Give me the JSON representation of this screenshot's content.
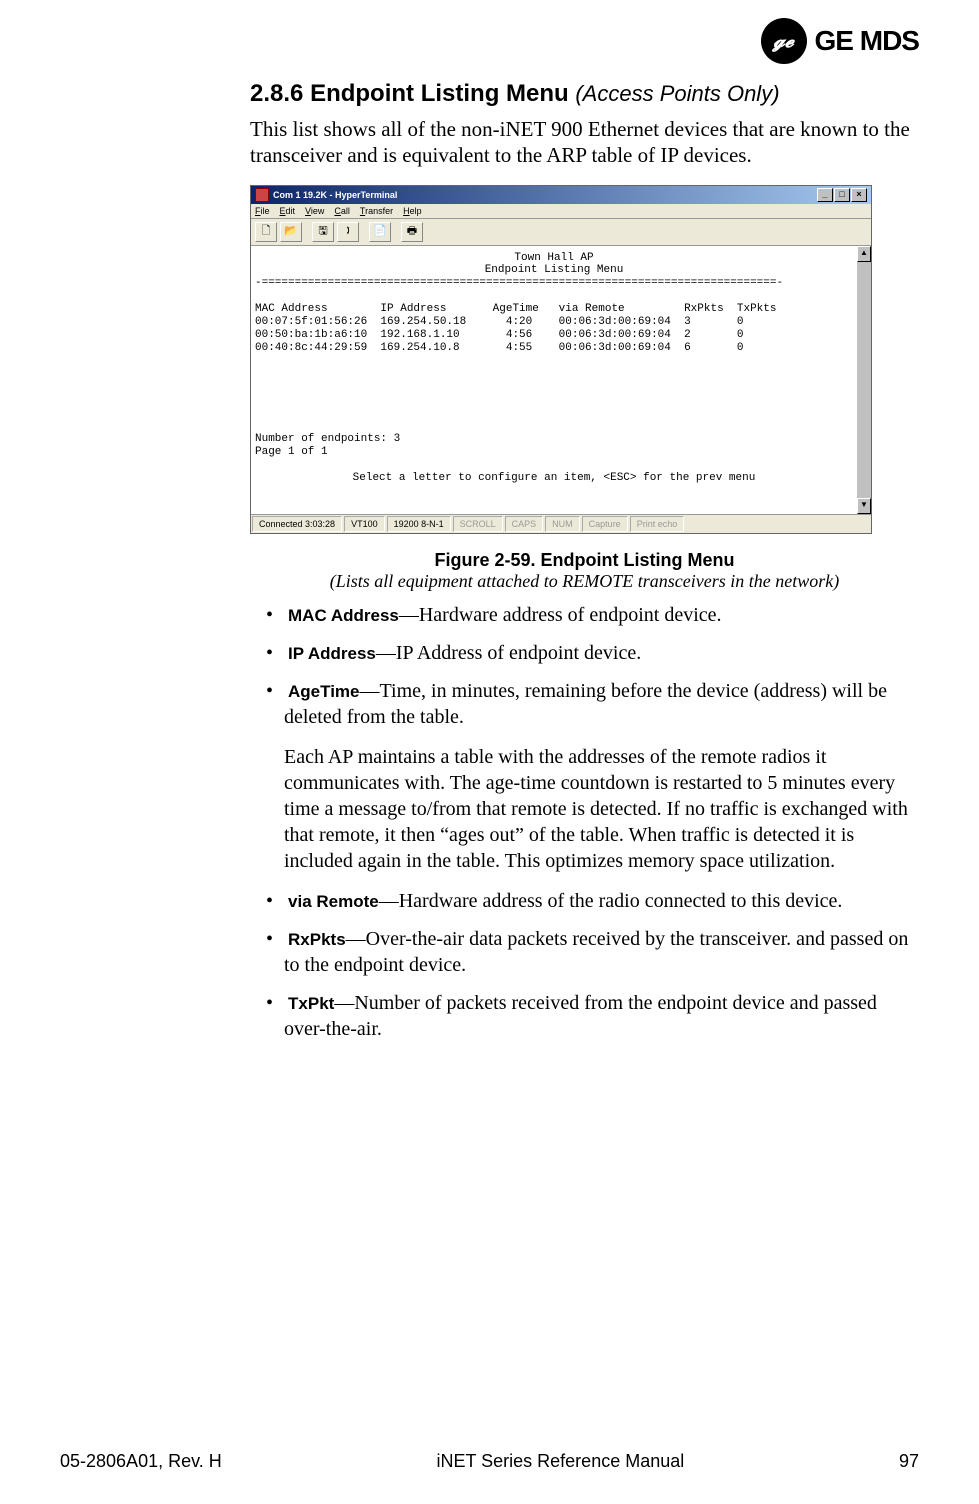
{
  "logo": {
    "monogram": "𝓰𝓮",
    "brand": "GE MDS"
  },
  "section": {
    "number": "2.8.6",
    "title": "Endpoint Listing Menu",
    "qualifier": "(Access Points Only)"
  },
  "intro": "This list shows all of the non-iNET 900 Ethernet devices that are known to the transceiver and is equivalent to the ARP table of IP devices.",
  "terminal": {
    "title": "Com 1 19.2K - HyperTerminal",
    "window_controls": {
      "min": "_",
      "max": "□",
      "close": "×"
    },
    "menu": [
      "File",
      "Edit",
      "View",
      "Call",
      "Transfer",
      "Help"
    ],
    "toolbar": [
      "🗋",
      "📂",
      "🖫",
      "🕽",
      "📄",
      "🖶"
    ],
    "scroll": {
      "up": "▲",
      "down": "▼"
    },
    "header1": "Town Hall AP",
    "header2": "Endpoint Listing Menu",
    "divider": "-==============================================================================-",
    "colhead": "MAC Address        IP Address       AgeTime   via Remote         RxPkts  TxPkts",
    "rows": [
      "00:07:5f:01:56:26  169.254.50.18      4:20    00:06:3d:00:69:04  3       0",
      "00:50:ba:1b:a6:10  192.168.1.10       4:56    00:06:3d:00:69:04  2       0",
      "00:40:8c:44:29:59  169.254.10.8       4:55    00:06:3d:00:69:04  6       0"
    ],
    "count": "Number of endpoints: 3",
    "page": "Page 1 of 1",
    "hint": "Select a letter to configure an item, <ESC> for the prev menu",
    "status": {
      "conn": "Connected 3:03:28",
      "emu": "VT100",
      "speed": "19200 8-N-1",
      "scroll": "SCROLL",
      "caps": "CAPS",
      "num": "NUM",
      "capture": "Capture",
      "echo": "Print echo"
    }
  },
  "figure": {
    "title": "Figure 2-59. Endpoint Listing Menu",
    "sub": "(Lists all equipment attached to REMOTE transceivers in the network)"
  },
  "defs": {
    "mac": {
      "label": "MAC Address",
      "text": "—Hardware address of endpoint device."
    },
    "ip": {
      "label": "IP Address",
      "text": "—IP Address of endpoint device."
    },
    "agetime": {
      "label": "AgeTime",
      "text": "—Time, in minutes, remaining before the device (address) will be deleted from the table."
    },
    "agepara": "Each AP maintains a table with the addresses of the remote radios it communicates with. The age-time countdown is restarted to 5 minutes every time a message to/from that remote is detected. If no traffic is exchanged with that remote, it then “ages out” of the table. When traffic is detected it is included again in the table. This optimizes memory space utilization.",
    "viaremote": {
      "label": "via Remote",
      "text": "—Hardware address of the radio connected to this device."
    },
    "rxpkts": {
      "label": "RxPkts",
      "text": "—Over-the-air data packets received by the transceiver. and passed on to the endpoint device."
    },
    "txpkt": {
      "label": "TxPkt",
      "text": "—Number of packets received from the endpoint device and passed over-the-air."
    }
  },
  "footer": {
    "left": "05-2806A01, Rev. H",
    "center": "iNET Series Reference Manual",
    "right": "97"
  }
}
